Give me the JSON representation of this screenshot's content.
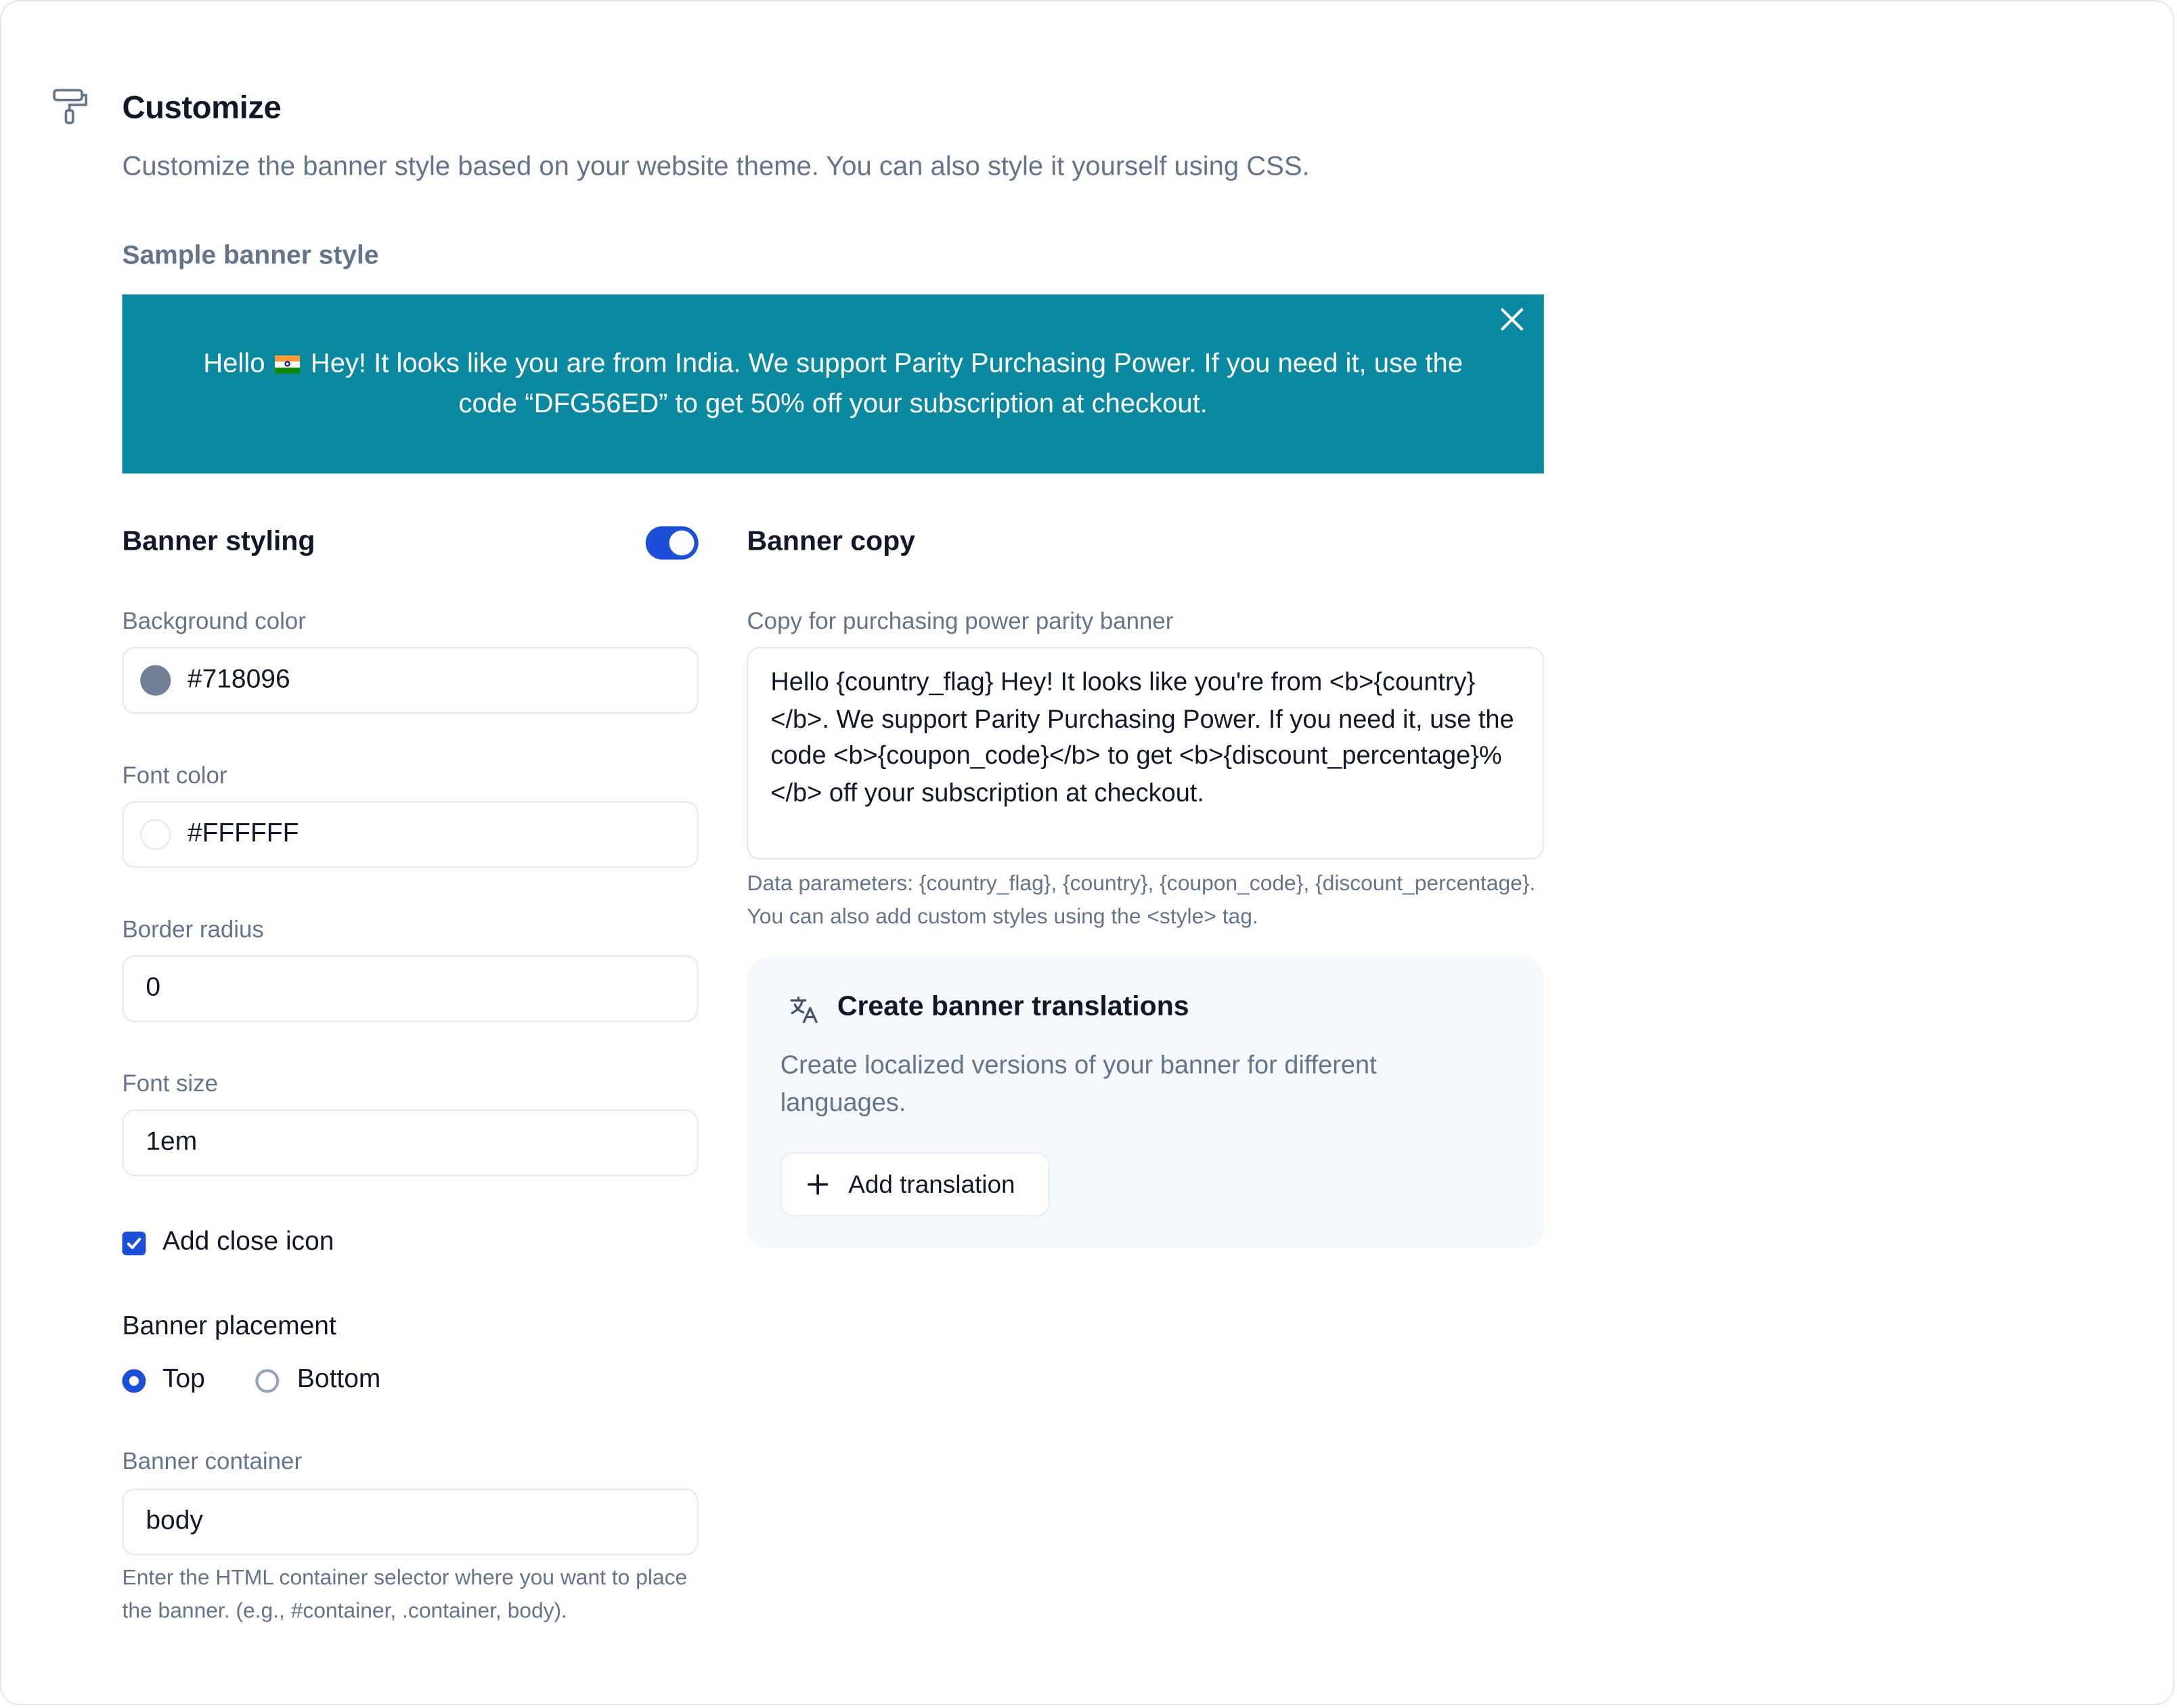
{
  "header": {
    "icon": "paint-roller-icon",
    "title": "Customize",
    "subtitle": "Customize the banner style based on your website theme. You can also style it yourself using CSS."
  },
  "sample": {
    "label": "Sample banner style",
    "banner_text_before_flag": "Hello",
    "flag": "India flag",
    "banner_text_after_flag": "Hey! It looks like you are from India. We support Parity Purchasing Power. If you need it, use the code “DFG56ED” to get 50% off your subscription at checkout.",
    "background": "#0a89a0",
    "close_icon": "close-icon"
  },
  "styling": {
    "title": "Banner styling",
    "toggle_on": true,
    "toggle_color": "#1d4ed8",
    "background_color": {
      "label": "Background color",
      "value": "#718096"
    },
    "font_color": {
      "label": "Font color",
      "value": "#FFFFFF"
    },
    "border_radius": {
      "label": "Border radius",
      "value": "0"
    },
    "font_size": {
      "label": "Font size",
      "value": "1em"
    },
    "close_icon_checkbox": {
      "label": "Add close icon",
      "checked": true
    },
    "placement": {
      "title": "Banner placement",
      "options": [
        {
          "label": "Top",
          "selected": true
        },
        {
          "label": "Bottom",
          "selected": false
        }
      ]
    },
    "container": {
      "label": "Banner container",
      "value": "body",
      "help": "Enter the HTML container selector where you want to place the banner. (e.g., #container, .container, body)."
    }
  },
  "copy": {
    "title": "Banner copy",
    "label": "Copy for purchasing power parity banner",
    "value": "Hello {country_flag} Hey! It looks like you're from <b>{country}</b>. We support Parity Purchasing Power. If you need it, use the code <b>{coupon_code}</b> to get <b>{discount_percentage}%</b> off your subscription at checkout.",
    "help": "Data parameters: {country_flag}, {country}, {coupon_code}, {discount_percentage}. You can also add custom styles using the <style> tag."
  },
  "translations": {
    "icon": "translate-icon",
    "title": "Create banner translations",
    "description": "Create localized versions of your banner for different languages.",
    "button_icon": "plus-icon",
    "button_label": "Add translation"
  }
}
